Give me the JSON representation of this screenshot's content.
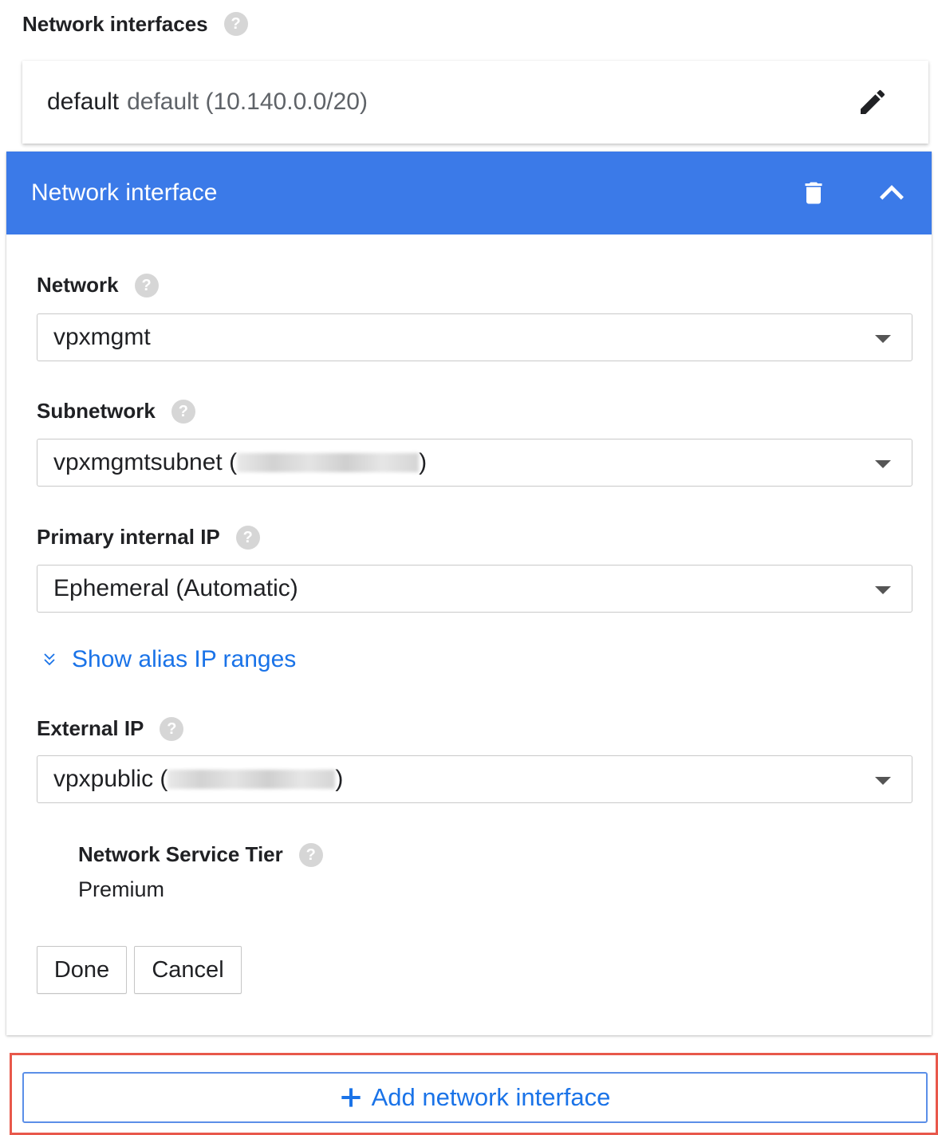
{
  "header": {
    "title": "Network interfaces",
    "help": "?"
  },
  "existing_interface": {
    "name": "default",
    "detail": "default (10.140.0.0/20)"
  },
  "panel": {
    "title": "Network interface"
  },
  "fields": {
    "network": {
      "label": "Network",
      "value": "vpxmgmt"
    },
    "subnetwork": {
      "label": "Subnetwork",
      "value_prefix": "vpxmgmtsubnet (",
      "value_suffix": ")"
    },
    "primary_ip": {
      "label": "Primary internal IP",
      "value": "Ephemeral (Automatic)"
    },
    "alias_link": "Show alias IP ranges",
    "external_ip": {
      "label": "External IP",
      "value_prefix": "vpxpublic (",
      "value_suffix": ")"
    },
    "service_tier": {
      "label": "Network Service Tier",
      "value": "Premium"
    }
  },
  "buttons": {
    "done": "Done",
    "cancel": "Cancel",
    "add": "Add network interface"
  },
  "colors": {
    "header_blue": "#3b7ae8",
    "link_blue": "#1a73e8",
    "highlight_red": "#e8584b"
  },
  "icons": {
    "help": "help-circle-icon",
    "edit": "pencil-icon",
    "delete": "trash-icon",
    "collapse": "chevron-up-icon",
    "expand_alias": "double-chevron-down-icon",
    "dropdown": "caret-down-icon",
    "add": "plus-icon"
  }
}
